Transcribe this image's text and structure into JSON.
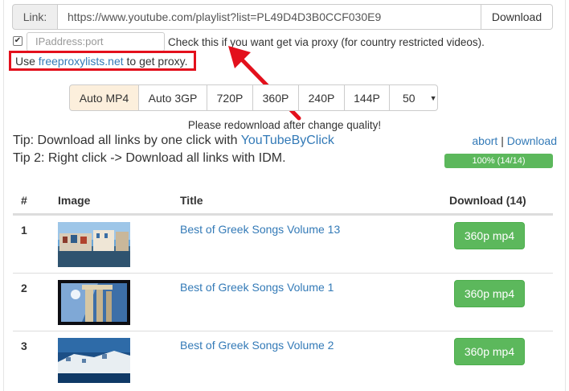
{
  "linkbar": {
    "label": "Link:",
    "url": "https://www.youtube.com/playlist?list=PL49D4D3B0CCF030E9",
    "download_label": "Download"
  },
  "proxy": {
    "checked_glyph": "✔",
    "placeholder": "IPaddress:port",
    "note": "Check this if you want get via proxy (for country restricted videos).",
    "hint_prefix": "Use ",
    "hint_link": "freeproxylists.net",
    "hint_suffix": " to get proxy."
  },
  "quality": {
    "options": [
      "Auto MP4",
      "Auto 3GP",
      "720P",
      "360P",
      "240P",
      "144P"
    ],
    "selected_value": "50",
    "selected_index": 0
  },
  "redownload_note": "Please redownload after change quality!",
  "tips": {
    "tip1_prefix": "Tip: Download all links by one click with ",
    "tip1_link": "YouTubeByClick",
    "tip2": "Tip 2: Right click -> Download all links with IDM."
  },
  "actions": {
    "abort": "abort",
    "separator": " | ",
    "download": "Download"
  },
  "progress": {
    "label": "100% (14/14)",
    "fraction": 1.0
  },
  "table": {
    "headers": {
      "num": "#",
      "image": "Image",
      "title": "Title",
      "download": "Download (14)"
    },
    "rows": [
      {
        "num": "1",
        "title": "Best of Greek Songs Volume 13",
        "button": "360p mp4"
      },
      {
        "num": "2",
        "title": "Best of Greek Songs Volume 1",
        "button": "360p mp4"
      },
      {
        "num": "3",
        "title": "Best of Greek Songs Volume 2",
        "button": "360p mp4"
      }
    ]
  },
  "colors": {
    "accent_link": "#337ab7",
    "success": "#5cb85c",
    "highlight_red": "#e3101c",
    "active_quality": "#fcefdc"
  }
}
